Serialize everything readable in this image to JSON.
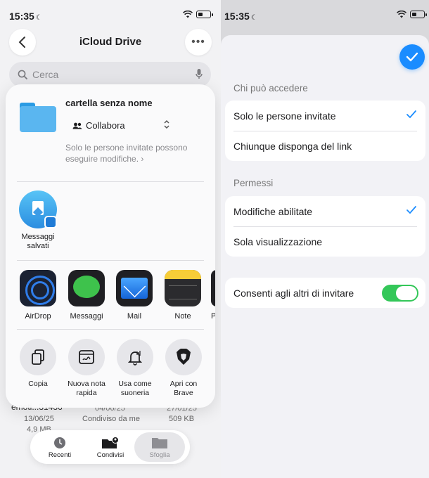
{
  "left": {
    "status": {
      "time": "15:35"
    },
    "nav": {
      "title": "iCloud Drive"
    },
    "search": {
      "placeholder": "Cerca"
    },
    "background": {
      "file_name": "emoti...31436",
      "file_date_1": "13/06/25",
      "file_size_1": "4,9 MB",
      "file_date_2": "04/06/25",
      "file_shared": "Condiviso da me",
      "file_date_3": "27/01/25",
      "file_size_3": "509 KB"
    },
    "share_sheet": {
      "folder_name": "cartella senza nome",
      "collab_label": "Collabora",
      "permission_desc": "Solo le persone invitate possono eseguire modifiche.",
      "contact": {
        "label": "Messaggi salvati",
        "icon": "telegram-saved-icon"
      },
      "apps": [
        {
          "label": "AirDrop",
          "icon": "airdrop-icon"
        },
        {
          "label": "Messaggi",
          "icon": "messages-icon"
        },
        {
          "label": "Mail",
          "icon": "mail-icon"
        },
        {
          "label": "Note",
          "icon": "notes-icon"
        },
        {
          "label": "P"
        }
      ],
      "actions": [
        {
          "label": "Copia",
          "icon": "copy-icon"
        },
        {
          "label": "Nuova nota rapida",
          "icon": "quick-note-icon"
        },
        {
          "label": "Usa come suoneria",
          "icon": "ringtone-icon"
        },
        {
          "label": "Apri con Brave",
          "icon": "brave-icon"
        }
      ]
    },
    "tabbar": {
      "tabs": [
        {
          "label": "Recenti",
          "icon": "clock-icon"
        },
        {
          "label": "Condivisi",
          "icon": "shared-folder-icon"
        },
        {
          "label": "Sfoglia",
          "icon": "folder-icon"
        }
      ],
      "active": "Sfoglia"
    }
  },
  "right": {
    "status": {
      "time": "15:35"
    },
    "access": {
      "header": "Chi può accedere",
      "options": [
        {
          "label": "Solo le persone invitate",
          "selected": true
        },
        {
          "label": "Chiunque disponga del link",
          "selected": false
        }
      ]
    },
    "permissions": {
      "header": "Permessi",
      "options": [
        {
          "label": "Modifiche abilitate",
          "selected": true
        },
        {
          "label": "Sola visualizzazione",
          "selected": false
        }
      ]
    },
    "invite_toggle": {
      "label": "Consenti agli altri di invitare",
      "on": true
    },
    "colors": {
      "accent": "#1a8cff",
      "toggle_on": "#34c759"
    }
  }
}
